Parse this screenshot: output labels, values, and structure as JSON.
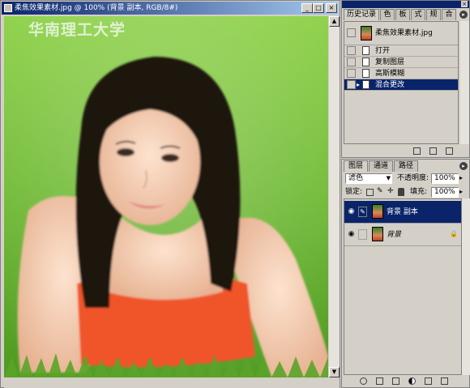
{
  "document_window": {
    "title": "柔焦效果素材.jpg @ 100% (背景 副本, RGB/8#)",
    "watermark": "华南理工大学",
    "buttons": {
      "minimize": "_",
      "maximize": "□",
      "close": "×"
    }
  },
  "history_palette": {
    "tabs": [
      "历史记录",
      "色",
      "板",
      "式",
      "规",
      "合"
    ],
    "snapshot_label": "柔焦效果素材.jpg",
    "steps": [
      {
        "label": "打开",
        "selected": false
      },
      {
        "label": "复制图层",
        "selected": false
      },
      {
        "label": "高斯模糊",
        "selected": false
      },
      {
        "label": "混合更改",
        "selected": true
      }
    ]
  },
  "layers_palette": {
    "tabs": [
      "图层",
      "通道",
      "路径"
    ],
    "blend_mode": "滤色",
    "opacity_label": "不透明度:",
    "opacity_value": "100%",
    "lock_label": "锁定:",
    "fill_label": "填充:",
    "fill_value": "100%",
    "layers": [
      {
        "name": "背景 副本",
        "selected": true,
        "locked": false
      },
      {
        "name": "背景",
        "selected": false,
        "locked": true
      }
    ]
  },
  "colors": {
    "titlebar_start": "#0a246a",
    "titlebar_end": "#a6caf0",
    "selection": "#0a246a",
    "panel_bg": "#d4d0c8"
  }
}
